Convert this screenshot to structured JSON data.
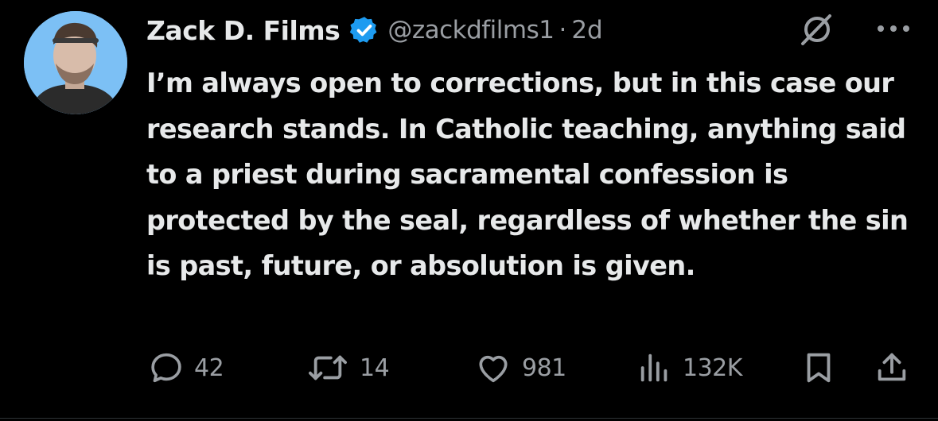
{
  "tweet": {
    "author_name": "Zack D. Films",
    "handle": "@zackdfilms1",
    "separator": "·",
    "time": "2d",
    "text": "I’m always open to corrections, but in this case our research stands. In Catholic teaching, anything said to a priest during sacramental confession is protected by the seal, regardless of whether the sin is past, future, or absolution is given."
  },
  "actions": {
    "replies": "42",
    "reposts": "14",
    "likes": "981",
    "views": "132K"
  },
  "icons": {
    "verified": "verified-badge-icon",
    "grok": "grok-icon",
    "more": "more-icon",
    "reply": "reply-icon",
    "repost": "repost-icon",
    "like": "heart-icon",
    "views": "views-icon",
    "bookmark": "bookmark-icon",
    "share": "share-icon"
  },
  "colors": {
    "background": "#000000",
    "text": "#e7e9ea",
    "secondary": "#9a9ea3",
    "verified": "#1d9bf0",
    "avatar_bg": "#7cc0f5"
  }
}
